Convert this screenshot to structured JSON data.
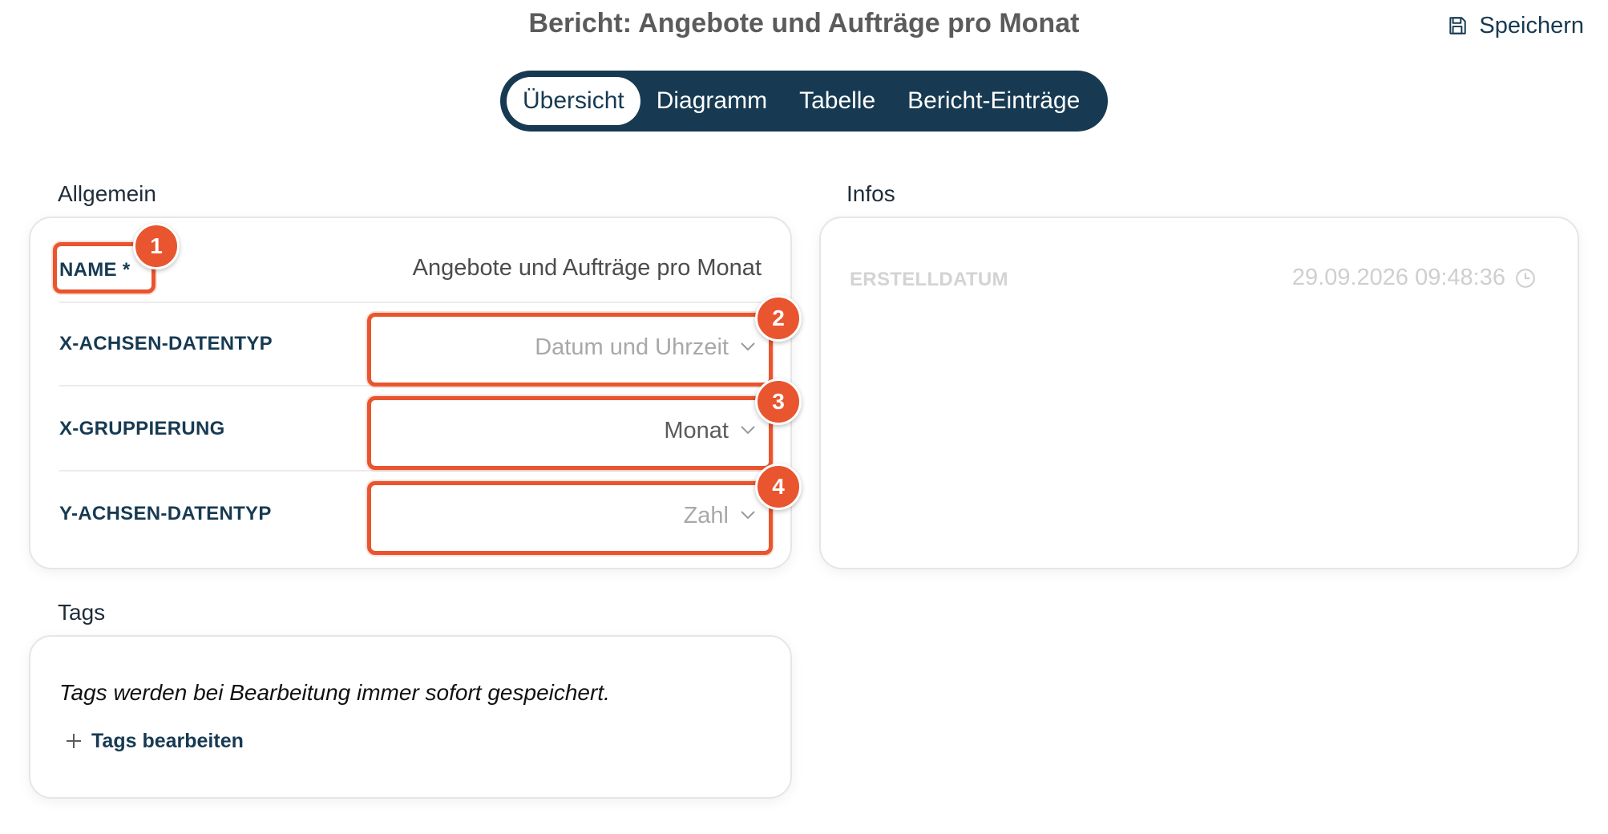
{
  "header": {
    "title": "Bericht: Angebote und Aufträge pro Monat",
    "save_label": "Speichern"
  },
  "tabs": [
    {
      "label": "Übersicht",
      "active": true
    },
    {
      "label": "Diagramm",
      "active": false
    },
    {
      "label": "Tabelle",
      "active": false
    },
    {
      "label": "Bericht-Einträge",
      "active": false
    }
  ],
  "allgemein": {
    "heading": "Allgemein",
    "fields": [
      {
        "label": "NAME *",
        "value": "Angebote und Aufträge pro Monat",
        "badge": "1"
      },
      {
        "label": "X-ACHSEN-DATENTYP",
        "value": "Datum und Uhrzeit",
        "badge": "2"
      },
      {
        "label": "X-GRUPPIERUNG",
        "value": "Monat",
        "badge": "3"
      },
      {
        "label": "Y-ACHSEN-DATENTYP",
        "value": "Zahl",
        "badge": "4"
      }
    ]
  },
  "infos": {
    "heading": "Infos",
    "created_label": "ERSTELLDATUM",
    "created_value": "29.09.2026 09:48:36"
  },
  "tags": {
    "heading": "Tags",
    "note": "Tags werden bei Bearbeitung immer sofort gespeichert.",
    "edit_label": "Tags bearbeiten"
  },
  "colors": {
    "primary": "#173a52",
    "highlight": "#e8552f",
    "title_gray": "#5b5b5b"
  },
  "icons": {
    "save": "floppy-disk-icon",
    "dropdown": "chevron-down-icon",
    "clock": "clock-icon",
    "add": "plus-icon"
  }
}
